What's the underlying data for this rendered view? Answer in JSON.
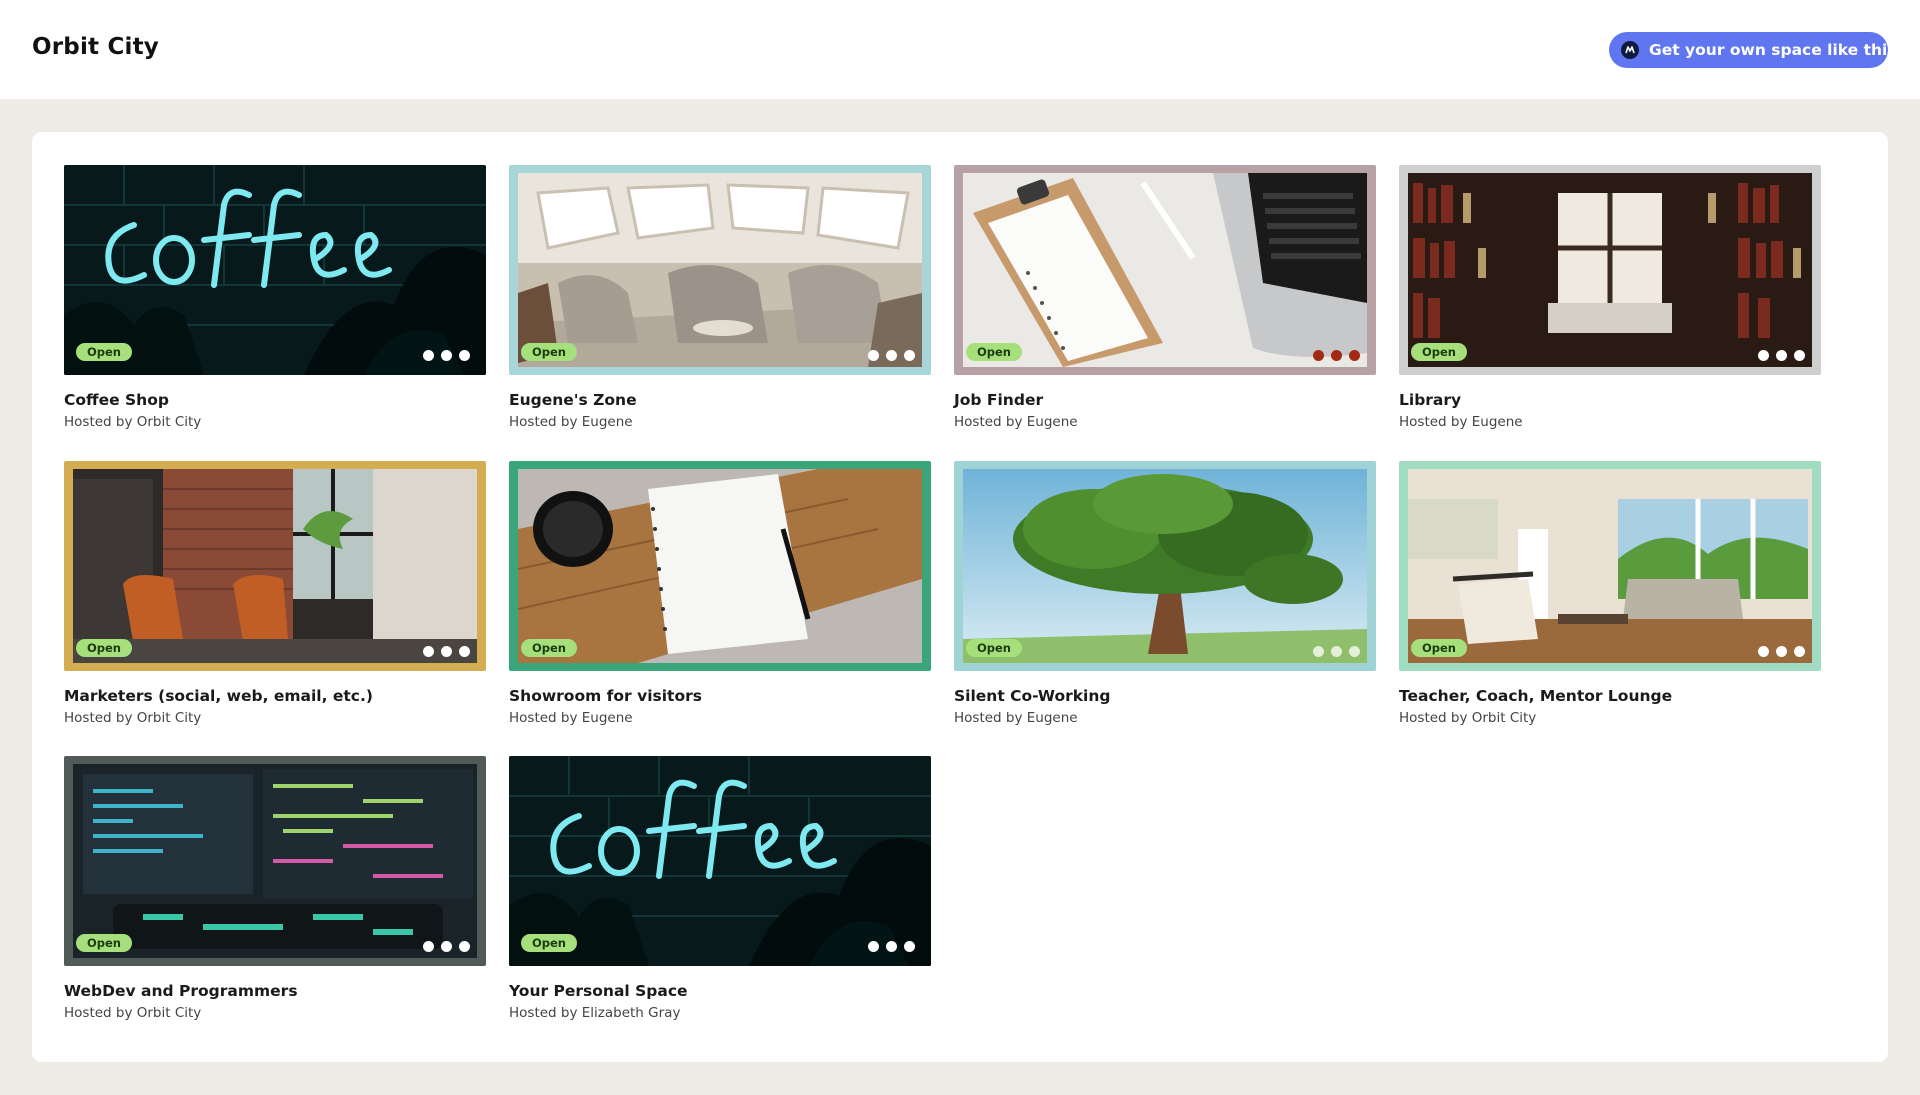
{
  "header": {
    "brand": "Orbit City",
    "cta_label": "Get your own space like this"
  },
  "colors": {
    "accent": "#5f76f0",
    "badge": "#a6e07c",
    "page_background": "#efebe6"
  },
  "cards": [
    {
      "title": "Coffee Shop",
      "host": "Hosted by Orbit City",
      "status": "Open",
      "frame_color": "#0b1414",
      "dot_color": "#ffffff"
    },
    {
      "title": "Eugene's Zone",
      "host": "Hosted by Eugene",
      "status": "Open",
      "frame_color": "#a7d5d8",
      "dot_color": "#ffffff"
    },
    {
      "title": "Job Finder",
      "host": "Hosted by Eugene",
      "status": "Open",
      "frame_color": "#b7a1a4",
      "dot_color": "#a32912"
    },
    {
      "title": "Library",
      "host": "Hosted by Eugene",
      "status": "Open",
      "frame_color": "#cfcfcf",
      "dot_color": "#ffffff"
    },
    {
      "title": "Marketers (social, web, email, etc.)",
      "host": "Hosted by Orbit City",
      "status": "Open",
      "frame_color": "#d3ad52",
      "dot_color": "#ffffff"
    },
    {
      "title": "Showroom for visitors",
      "host": "Hosted by Eugene",
      "status": "Open",
      "frame_color": "#3aa579",
      "dot_color": "#ffffff"
    },
    {
      "title": "Silent Co-Working",
      "host": "Hosted by Eugene",
      "status": "Open",
      "frame_color": "#9fd3d6",
      "dot_color": "#ffffff"
    },
    {
      "title": "Teacher, Coach, Mentor Lounge",
      "host": "Hosted by Orbit City",
      "status": "Open",
      "frame_color": "#9fdcc1",
      "dot_color": "#ffffff"
    },
    {
      "title": "WebDev and Programmers",
      "host": "Hosted by Orbit City",
      "status": "Open",
      "frame_color": "#505a58",
      "dot_color": "#ffffff"
    },
    {
      "title": "Your Personal Space",
      "host": "Hosted by Elizabeth Gray",
      "status": "Open",
      "frame_color": "#0b1414",
      "dot_color": "#ffffff"
    }
  ]
}
